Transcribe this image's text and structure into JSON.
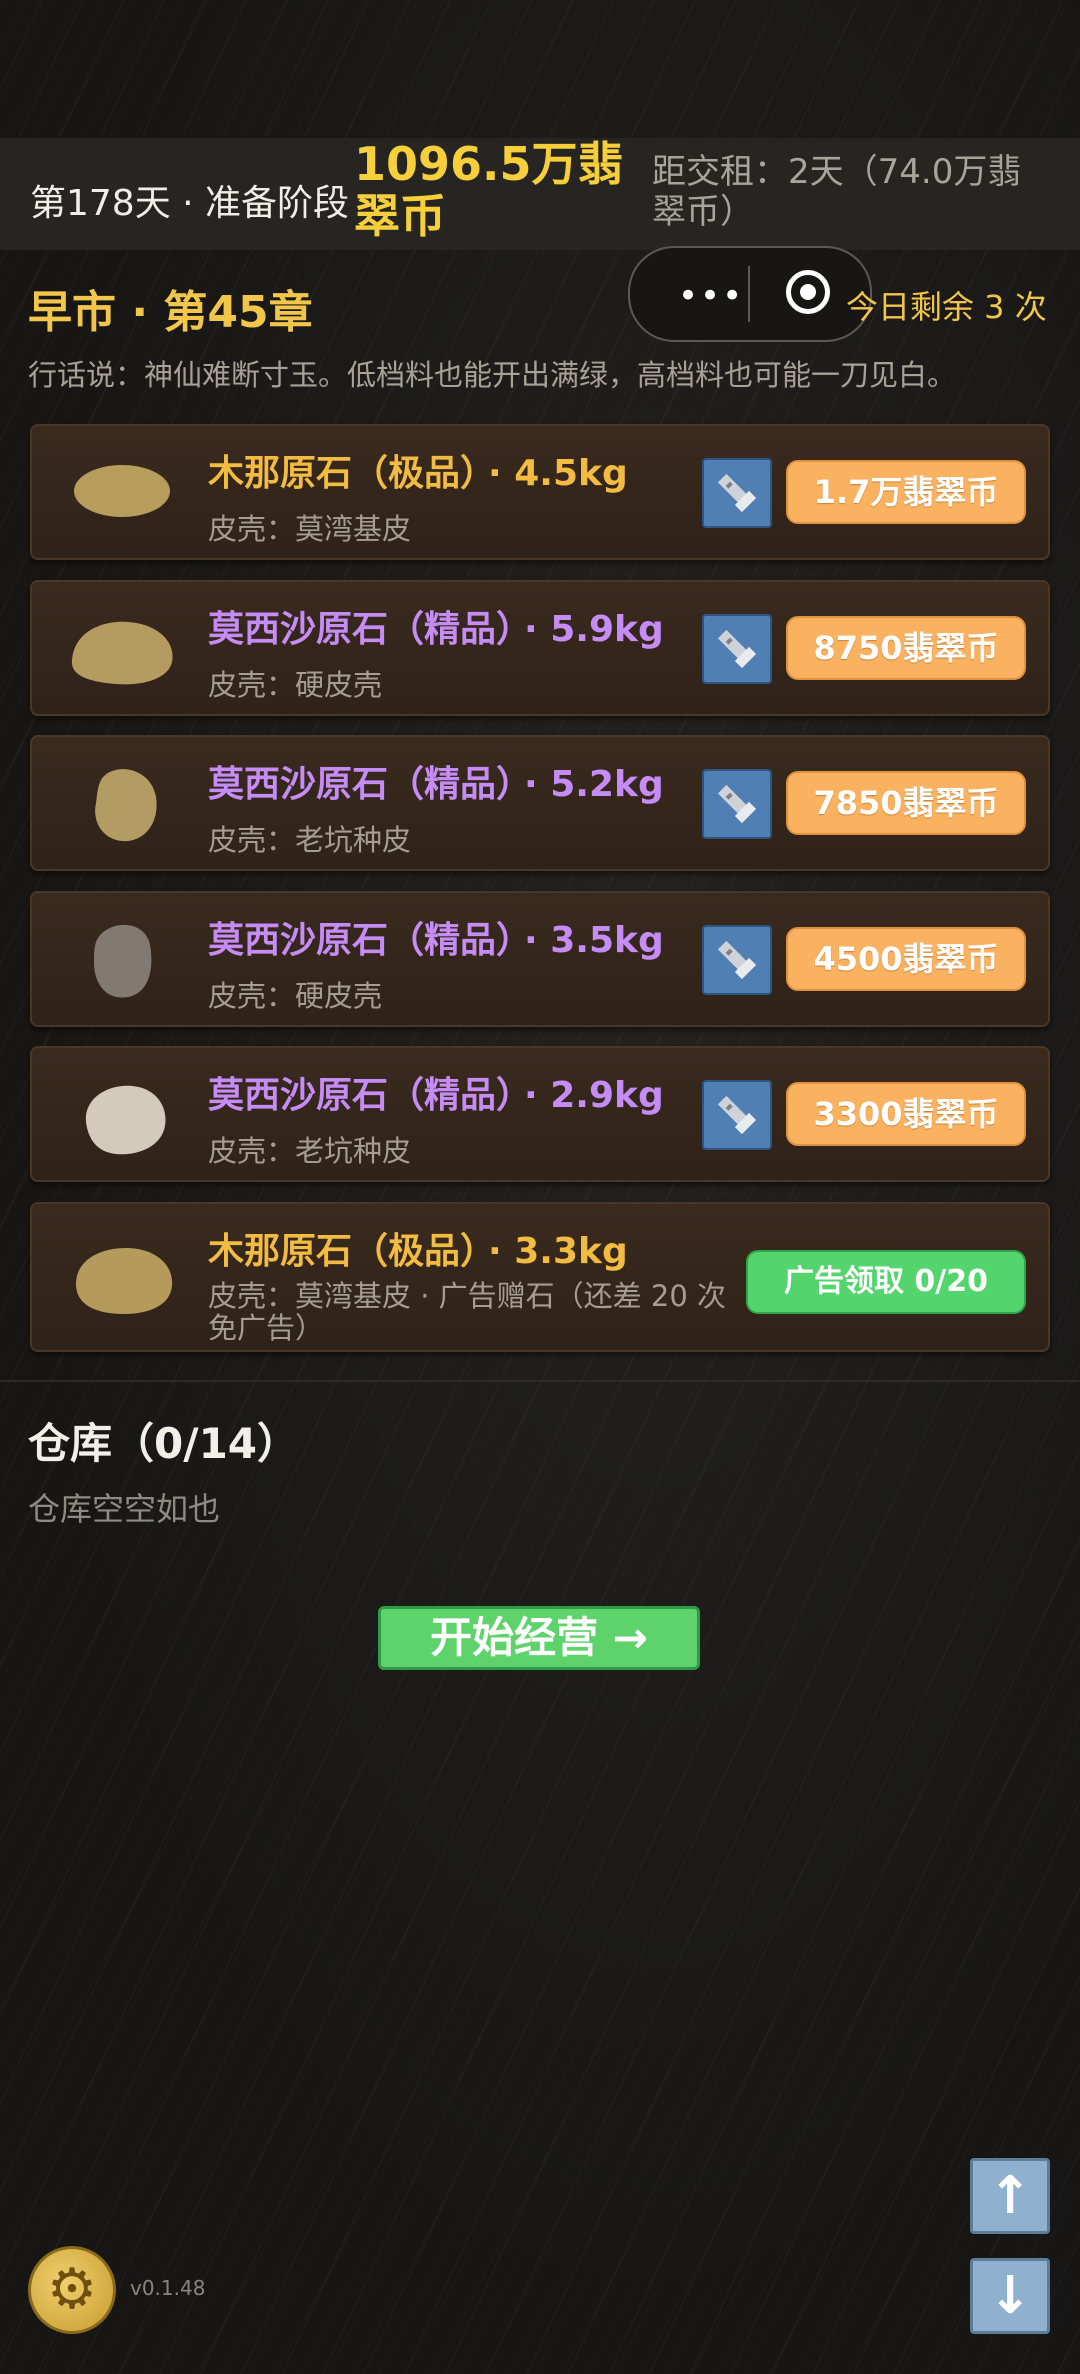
{
  "header": {
    "day_phase": "第178天 · 准备阶段",
    "money": "1096.5万翡翠币",
    "rent": "距交租：2天（74.0万翡翠币）"
  },
  "chapter": "早市 · 第45章",
  "remaining": "今日剩余 3 次",
  "saying": "行话说：神仙难断寸玉。低档料也能开出满绿，高档料也可能一刀见白。",
  "stones": [
    {
      "name": "木那原石（极品）",
      "weight": "· 4.5kg",
      "skin": "皮壳：莫湾基皮",
      "price": "1.7万翡翠币",
      "color": "#b79d5b",
      "name_color": "gold"
    },
    {
      "name": "莫西沙原石（精品）",
      "weight": "· 5.9kg",
      "skin": "皮壳：硬皮壳",
      "price": "8750翡翠币",
      "color": "#b49b60",
      "name_color": "purple"
    },
    {
      "name": "莫西沙原石（精品）",
      "weight": "· 5.2kg",
      "skin": "皮壳：老坑种皮",
      "price": "7850翡翠币",
      "color": "#b39c64",
      "name_color": "purple"
    },
    {
      "name": "莫西沙原石（精品）",
      "weight": "· 3.5kg",
      "skin": "皮壳：硬皮壳",
      "price": "4500翡翠币",
      "color": "#827a72",
      "name_color": "purple"
    },
    {
      "name": "莫西沙原石（精品）",
      "weight": "· 2.9kg",
      "skin": "皮壳：老坑种皮",
      "price": "3300翡翠币",
      "color": "#d4cabb",
      "name_color": "purple"
    }
  ],
  "ad_stone": {
    "name": "木那原石（极品）",
    "weight": "· 3.3kg",
    "skin": "皮壳：莫湾基皮 · 广告赠石（还差 20 次免广告）",
    "button": "广告领取 0/20",
    "color": "#b49b5c"
  },
  "warehouse": {
    "title": "仓库（0/14）",
    "empty": "仓库空空如也"
  },
  "start_button": "开始经营 →",
  "version": "v0.1.48",
  "capsule": {
    "dots": "•••"
  },
  "icons": {
    "settings": "gear-icon",
    "up": "arrow-up-icon",
    "down": "arrow-down-icon",
    "torch": "flashlight-icon"
  }
}
